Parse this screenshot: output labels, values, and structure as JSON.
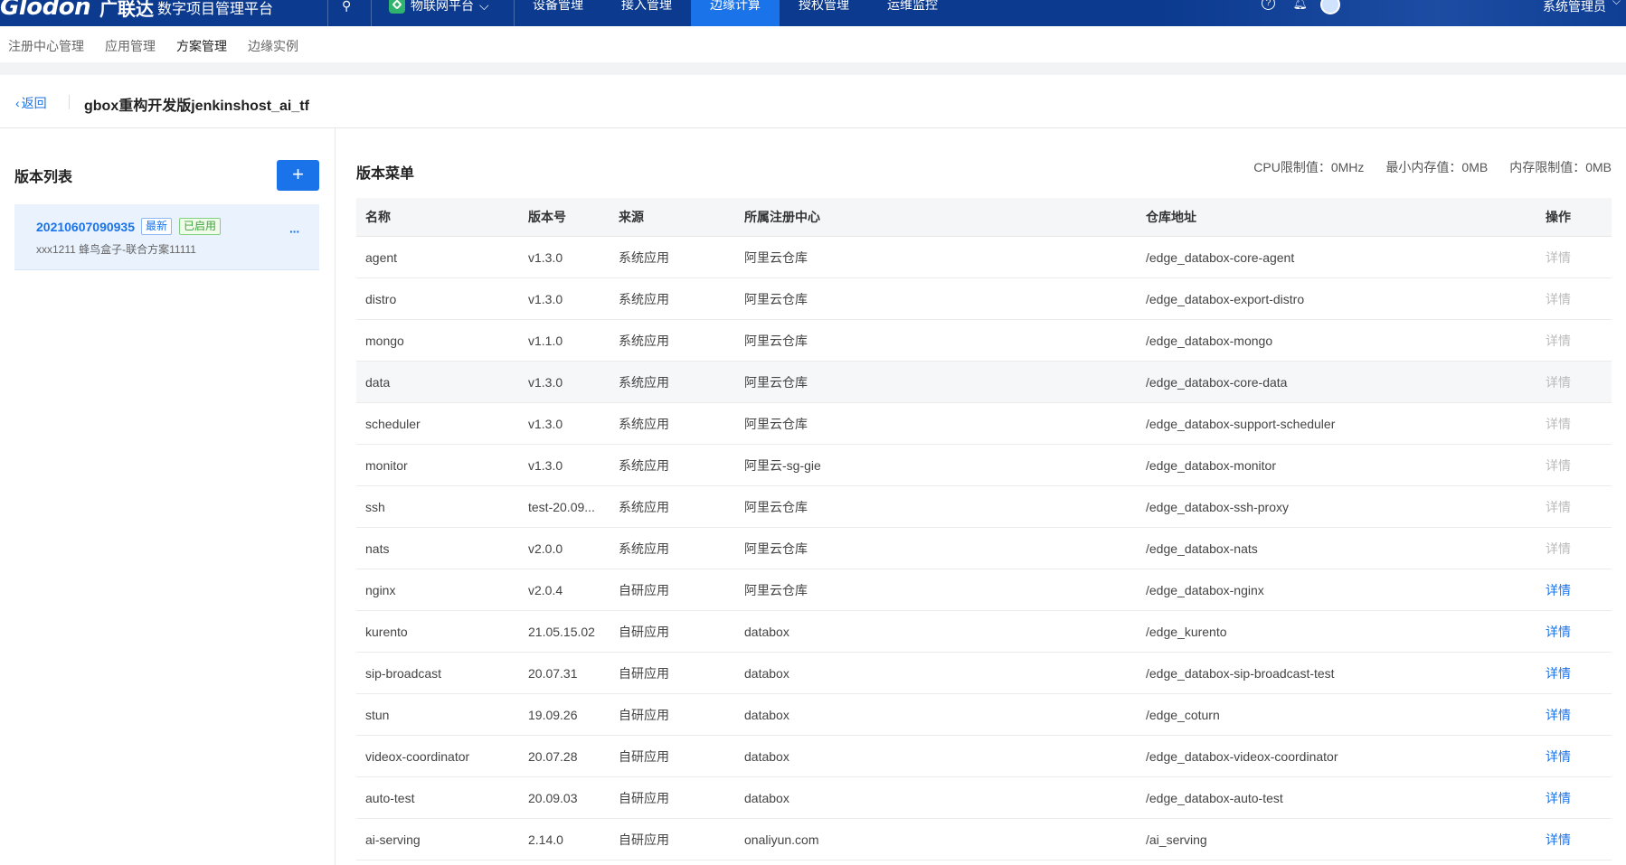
{
  "topbar": {
    "logo": "Glodon",
    "logo_cn": "广联达",
    "platform": "数字项目管理平台",
    "iot_platform": "物联网平台",
    "nav": [
      "设备管理",
      "接入管理",
      "边缘计算",
      "授权管理",
      "运维监控"
    ],
    "active_nav": "边缘计算",
    "user": "系统管理员"
  },
  "subtabs": [
    "注册中心管理",
    "应用管理",
    "方案管理",
    "边缘实例"
  ],
  "active_subtab": "方案管理",
  "header": {
    "back": "返回",
    "title": "gbox重构开发版jenkinshost_ai_tf"
  },
  "left": {
    "title": "版本列表",
    "add_label": "+",
    "versions": [
      {
        "id": "20210607090935",
        "badge_latest": "最新",
        "badge_enabled": "已启用",
        "desc": "xxx1211 蜂鸟盒子-联合方案11111",
        "more": "···"
      }
    ]
  },
  "right": {
    "title": "版本菜单",
    "limits": {
      "cpu": "CPU限制值：0MHz",
      "min_mem": "最小内存值：0MB",
      "mem_limit": "内存限制值：0MB"
    },
    "columns": [
      "名称",
      "版本号",
      "来源",
      "所属注册中心",
      "仓库地址",
      "操作"
    ],
    "rows": [
      {
        "name": "agent",
        "version": "v1.3.0",
        "source": "系统应用",
        "registry": "阿里云仓库",
        "repo": "/edge_databox-core-agent",
        "op": "详情",
        "enabled": false
      },
      {
        "name": "distro",
        "version": "v1.3.0",
        "source": "系统应用",
        "registry": "阿里云仓库",
        "repo": "/edge_databox-export-distro",
        "op": "详情",
        "enabled": false
      },
      {
        "name": "mongo",
        "version": "v1.1.0",
        "source": "系统应用",
        "registry": "阿里云仓库",
        "repo": "/edge_databox-mongo",
        "op": "详情",
        "enabled": false
      },
      {
        "name": "data",
        "version": "v1.3.0",
        "source": "系统应用",
        "registry": "阿里云仓库",
        "repo": "/edge_databox-core-data",
        "op": "详情",
        "enabled": false
      },
      {
        "name": "scheduler",
        "version": "v1.3.0",
        "source": "系统应用",
        "registry": "阿里云仓库",
        "repo": "/edge_databox-support-scheduler",
        "op": "详情",
        "enabled": false
      },
      {
        "name": "monitor",
        "version": "v1.3.0",
        "source": "系统应用",
        "registry": "阿里云-sg-gie",
        "repo": "/edge_databox-monitor",
        "op": "详情",
        "enabled": false
      },
      {
        "name": "ssh",
        "version": "test-20.09...",
        "source": "系统应用",
        "registry": "阿里云仓库",
        "repo": "/edge_databox-ssh-proxy",
        "op": "详情",
        "enabled": false
      },
      {
        "name": "nats",
        "version": "v2.0.0",
        "source": "系统应用",
        "registry": "阿里云仓库",
        "repo": "/edge_databox-nats",
        "op": "详情",
        "enabled": false
      },
      {
        "name": "nginx",
        "version": "v2.0.4",
        "source": "自研应用",
        "registry": "阿里云仓库",
        "repo": "/edge_databox-nginx",
        "op": "详情",
        "enabled": true
      },
      {
        "name": "kurento",
        "version": "21.05.15.02",
        "source": "自研应用",
        "registry": "databox",
        "repo": "/edge_kurento",
        "op": "详情",
        "enabled": true
      },
      {
        "name": "sip-broadcast",
        "version": "20.07.31",
        "source": "自研应用",
        "registry": "databox",
        "repo": "/edge_databox-sip-broadcast-test",
        "op": "详情",
        "enabled": true
      },
      {
        "name": "stun",
        "version": "19.09.26",
        "source": "自研应用",
        "registry": "databox",
        "repo": "/edge_coturn",
        "op": "详情",
        "enabled": true
      },
      {
        "name": "videox-coordinator",
        "version": "20.07.28",
        "source": "自研应用",
        "registry": "databox",
        "repo": "/edge_databox-videox-coordinator",
        "op": "详情",
        "enabled": true
      },
      {
        "name": "auto-test",
        "version": "20.09.03",
        "source": "自研应用",
        "registry": "databox",
        "repo": "/edge_databox-auto-test",
        "op": "详情",
        "enabled": true
      },
      {
        "name": "ai-serving",
        "version": "2.14.0",
        "source": "自研应用",
        "registry": "onaliyun.com",
        "repo": "/ai_serving",
        "op": "详情",
        "enabled": true
      }
    ]
  }
}
